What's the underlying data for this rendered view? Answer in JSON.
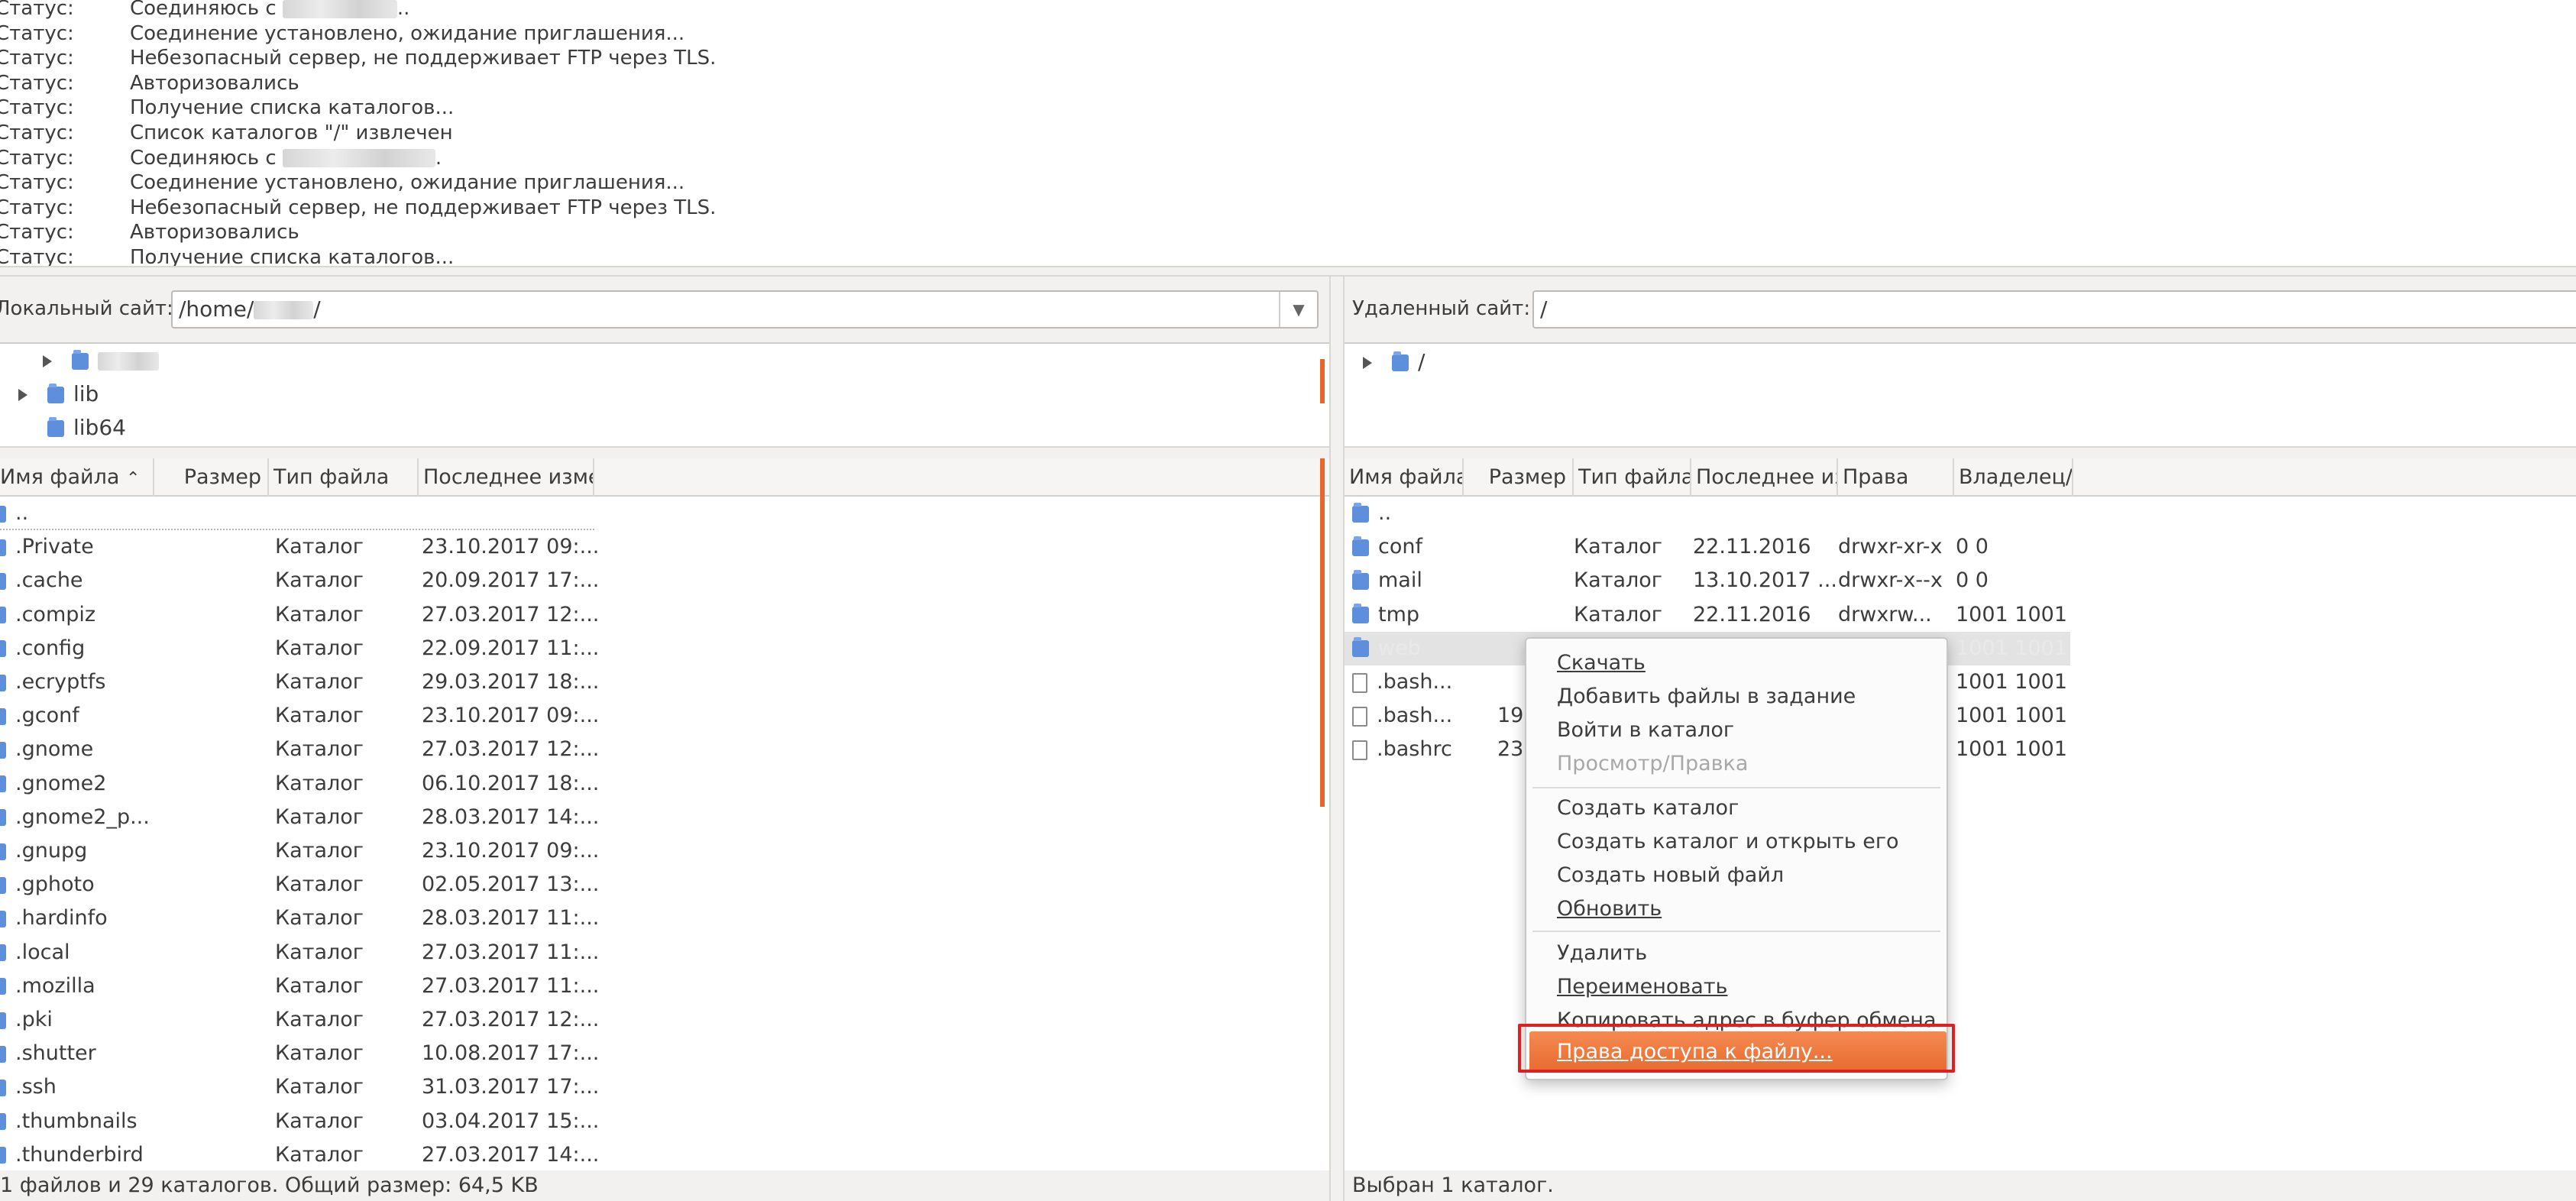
{
  "log": [
    {
      "label": "Статус:",
      "msg": "Соединяюсь с",
      "blur": true,
      "tail": ".."
    },
    {
      "label": "Статус:",
      "msg": "Соединение установлено, ожидание приглашения..."
    },
    {
      "label": "Статус:",
      "msg": "Небезопасный сервер, не поддерживает FTP через TLS."
    },
    {
      "label": "Статус:",
      "msg": "Авторизовались"
    },
    {
      "label": "Статус:",
      "msg": "Получение списка каталогов..."
    },
    {
      "label": "Статус:",
      "msg": "Список каталогов \"/\" извлечен"
    },
    {
      "label": "Статус:",
      "msg": "Соединяюсь с",
      "blur": true,
      "tail": "."
    },
    {
      "label": "Статус:",
      "msg": "Соединение установлено, ожидание приглашения..."
    },
    {
      "label": "Статус:",
      "msg": "Небезопасный сервер, не поддерживает FTP через TLS."
    },
    {
      "label": "Статус:",
      "msg": "Авторизовались"
    },
    {
      "label": "Статус:",
      "msg": "Получение списка каталогов..."
    }
  ],
  "local": {
    "site_label": "Локальный сайт:",
    "path": "/home/",
    "path_tail": "/",
    "tree": [
      {
        "label": "",
        "blur": true,
        "expander": true
      },
      {
        "label": "lib",
        "expander": true
      },
      {
        "label": "lib64",
        "expander": false
      }
    ],
    "columns": [
      "Имя файла",
      "Размер",
      "Тип файла",
      "Последнее изме"
    ],
    "sort_indicator": "^",
    "rows": [
      {
        "name": "..",
        "size": "",
        "type": "",
        "date": ""
      },
      {
        "name": ".Private",
        "size": "",
        "type": "Каталог",
        "date": "23.10.2017 09:..."
      },
      {
        "name": ".cache",
        "size": "",
        "type": "Каталог",
        "date": "20.09.2017 17:..."
      },
      {
        "name": ".compiz",
        "size": "",
        "type": "Каталог",
        "date": "27.03.2017 12:..."
      },
      {
        "name": ".config",
        "size": "",
        "type": "Каталог",
        "date": "22.09.2017 11:..."
      },
      {
        "name": ".ecryptfs",
        "size": "",
        "type": "Каталог",
        "date": "29.03.2017 18:..."
      },
      {
        "name": ".gconf",
        "size": "",
        "type": "Каталог",
        "date": "23.10.2017 09:..."
      },
      {
        "name": ".gnome",
        "size": "",
        "type": "Каталог",
        "date": "27.03.2017 12:..."
      },
      {
        "name": ".gnome2",
        "size": "",
        "type": "Каталог",
        "date": "06.10.2017 18:..."
      },
      {
        "name": ".gnome2_p...",
        "size": "",
        "type": "Каталог",
        "date": "28.03.2017 14:..."
      },
      {
        "name": ".gnupg",
        "size": "",
        "type": "Каталог",
        "date": "23.10.2017 09:..."
      },
      {
        "name": ".gphoto",
        "size": "",
        "type": "Каталог",
        "date": "02.05.2017 13:..."
      },
      {
        "name": ".hardinfo",
        "size": "",
        "type": "Каталог",
        "date": "28.03.2017 11:..."
      },
      {
        "name": ".local",
        "size": "",
        "type": "Каталог",
        "date": "27.03.2017 11:..."
      },
      {
        "name": ".mozilla",
        "size": "",
        "type": "Каталог",
        "date": "27.03.2017 11:..."
      },
      {
        "name": ".pki",
        "size": "",
        "type": "Каталог",
        "date": "27.03.2017 12:..."
      },
      {
        "name": ".shutter",
        "size": "",
        "type": "Каталог",
        "date": "10.08.2017 17:..."
      },
      {
        "name": ".ssh",
        "size": "",
        "type": "Каталог",
        "date": "31.03.2017 17:..."
      },
      {
        "name": ".thumbnails",
        "size": "",
        "type": "Каталог",
        "date": "03.04.2017 15:..."
      },
      {
        "name": ".thunderbird",
        "size": "",
        "type": "Каталог",
        "date": "27.03.2017 14:..."
      }
    ],
    "status": "1 файлов и 29 каталогов. Общий размер: 64,5 KB"
  },
  "remote": {
    "site_label": "Удаленный сайт:",
    "path": "/",
    "tree": [
      {
        "label": "/",
        "expander": true
      }
    ],
    "columns": [
      "Имя файла",
      "Размер",
      "Тип файла",
      "Последнее из",
      "Права",
      "Владелец/"
    ],
    "rows": [
      {
        "name": "..",
        "size": "",
        "type": "",
        "date": "",
        "perm": "",
        "owner": "",
        "kind": "folder"
      },
      {
        "name": "conf",
        "size": "",
        "type": "Каталог",
        "date": "22.11.2016",
        "perm": "drwxr-xr-x",
        "owner": "0 0",
        "kind": "folder"
      },
      {
        "name": "mail",
        "size": "",
        "type": "Каталог",
        "date": "13.10.2017 ...",
        "perm": "drwxr-x--x",
        "owner": "0 0",
        "kind": "folder"
      },
      {
        "name": "tmp",
        "size": "",
        "type": "Каталог",
        "date": "22.11.2016",
        "perm": "drwxrw...",
        "owner": "1001 1001",
        "kind": "folder"
      },
      {
        "name": "web",
        "size": "",
        "type": "",
        "date": "",
        "perm": "",
        "owner": "1001 1001",
        "kind": "folder",
        "selected": true
      },
      {
        "name": ".bash...",
        "size": "",
        "type": "",
        "date": "",
        "perm": "",
        "owner": "1001 1001",
        "kind": "file"
      },
      {
        "name": ".bash...",
        "size": "19",
        "type": "",
        "date": "",
        "perm": "",
        "owner": "1001 1001",
        "kind": "file"
      },
      {
        "name": ".bashrc",
        "size": "23",
        "type": "",
        "date": "",
        "perm": "",
        "owner": "1001 1001",
        "kind": "file"
      }
    ],
    "status": "Выбран 1 каталог."
  },
  "menu": {
    "download": "Скачать",
    "add_queue": "Добавить файлы в задание",
    "enter_dir": "Войти в каталог",
    "view_edit": "Просмотр/Правка",
    "create_dir": "Создать каталог",
    "create_dir_open": "Создать каталог и открыть его",
    "create_file": "Создать новый файл",
    "refresh": "Обновить",
    "delete": "Удалить",
    "rename": "Переименовать",
    "copy_url": "Копировать адрес в буфер обмена",
    "permissions": "Права доступа к файлу..."
  },
  "colors": {
    "accent": "#e8652b",
    "highlight_border": "#e02020",
    "folder": "#5d8fdd"
  }
}
